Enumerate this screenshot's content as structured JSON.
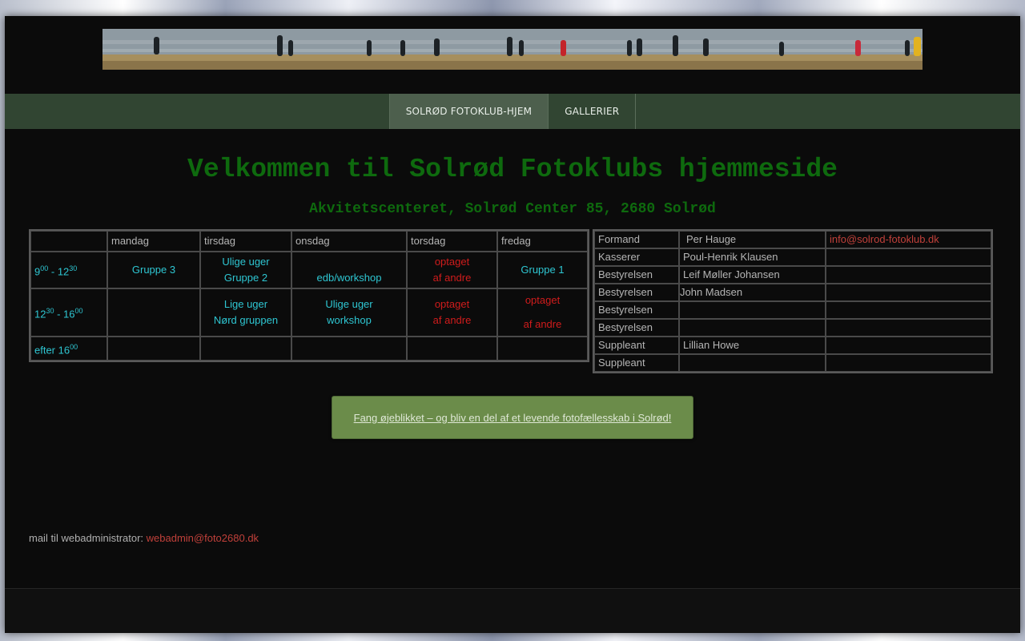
{
  "nav": {
    "items": [
      {
        "label": "SOLRØD FOTOKLUB-HJEM",
        "active": true
      },
      {
        "label": "GALLERIER",
        "active": false
      }
    ]
  },
  "heading": {
    "title": "Velkommen til Solrød Fotoklubs hjemmeside",
    "subtitle": "Akvitetscenteret, Solrød Center 85, 2680 Solrød"
  },
  "schedule": {
    "days": [
      "mandag",
      "tirsdag",
      "onsdag",
      "torsdag",
      "fredag"
    ],
    "rows": [
      {
        "time": {
          "a": "9",
          "a_sup": "00",
          "sep": " - ",
          "b": "12",
          "b_sup": "30"
        },
        "mandag": "Gruppe 3",
        "tirsdag": [
          "Ulige uger",
          "Gruppe 2"
        ],
        "onsdag": "edb/workshop",
        "torsdag": [
          "optaget",
          "af andre"
        ],
        "fredag": "Gruppe 1"
      },
      {
        "time": {
          "a": "12",
          "a_sup": "30",
          "sep": " - ",
          "b": "16",
          "b_sup": "00"
        },
        "tirsdag": [
          "Lige uger",
          "Nørd gruppen"
        ],
        "onsdag": [
          "Ulige uger",
          "workshop"
        ],
        "torsdag": [
          "optaget",
          "af andre"
        ],
        "fredag": [
          "optaget",
          "af andre"
        ]
      },
      {
        "time": {
          "a": "efter 16",
          "a_sup": "00"
        }
      }
    ]
  },
  "board": {
    "rows": [
      {
        "role": "Formand",
        "name": "Per Hauge",
        "contact": "info@solrod-fotoklub.dk"
      },
      {
        "role": "Kasserer",
        "name": "Poul-Henrik Klausen",
        "contact": ""
      },
      {
        "role": "Bestyrelsen",
        "name": "Leif Møller Johansen",
        "contact": ""
      },
      {
        "role": "Bestyrelsen",
        "name": "John Madsen",
        "contact": ""
      },
      {
        "role": "Bestyrelsen",
        "name": "",
        "contact": ""
      },
      {
        "role": "Bestyrelsen",
        "name": "",
        "contact": ""
      },
      {
        "role": "Suppleant",
        "name": "Lillian Howe",
        "contact": ""
      },
      {
        "role": "Suppleant",
        "name": "",
        "contact": ""
      }
    ]
  },
  "cta": {
    "label": "Fang øjeblikket – og bliv en del af et levende fotofællesskab i Solrød!"
  },
  "footer": {
    "prefix": "mail til webadministrator: ",
    "email": "webadmin@foto2680.dk"
  },
  "colors": {
    "heading": "#0e6a0e",
    "navbar": "#314532",
    "schedule_text": "#2ec6d2",
    "busy_text": "#d01c1c",
    "link": "#c0403a",
    "cta_bg": "#6b8c4a"
  }
}
